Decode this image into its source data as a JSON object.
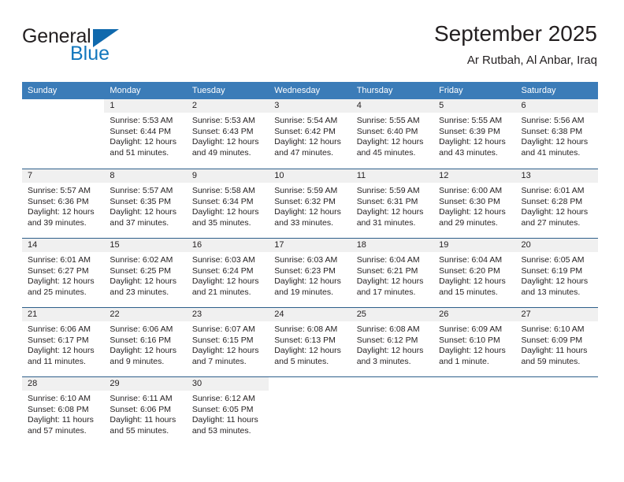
{
  "brand": {
    "name_part1": "General",
    "name_part2": "Blue",
    "triangle_color": "#1069ad",
    "blue_color": "#1277bd"
  },
  "header": {
    "title": "September 2025",
    "subtitle": "Ar Rutbah, Al Anbar, Iraq"
  },
  "calendar": {
    "header_bg": "#3b7cb8",
    "day_band_bg": "#f0f0f0",
    "row_divider": "#2e5f8a",
    "weekdays": [
      "Sunday",
      "Monday",
      "Tuesday",
      "Wednesday",
      "Thursday",
      "Friday",
      "Saturday"
    ],
    "weeks": [
      [
        {
          "day": "",
          "empty": true,
          "sunrise": "",
          "sunset": "",
          "daylight1": "",
          "daylight2": ""
        },
        {
          "day": "1",
          "sunrise": "Sunrise: 5:53 AM",
          "sunset": "Sunset: 6:44 PM",
          "daylight1": "Daylight: 12 hours",
          "daylight2": "and 51 minutes."
        },
        {
          "day": "2",
          "sunrise": "Sunrise: 5:53 AM",
          "sunset": "Sunset: 6:43 PM",
          "daylight1": "Daylight: 12 hours",
          "daylight2": "and 49 minutes."
        },
        {
          "day": "3",
          "sunrise": "Sunrise: 5:54 AM",
          "sunset": "Sunset: 6:42 PM",
          "daylight1": "Daylight: 12 hours",
          "daylight2": "and 47 minutes."
        },
        {
          "day": "4",
          "sunrise": "Sunrise: 5:55 AM",
          "sunset": "Sunset: 6:40 PM",
          "daylight1": "Daylight: 12 hours",
          "daylight2": "and 45 minutes."
        },
        {
          "day": "5",
          "sunrise": "Sunrise: 5:55 AM",
          "sunset": "Sunset: 6:39 PM",
          "daylight1": "Daylight: 12 hours",
          "daylight2": "and 43 minutes."
        },
        {
          "day": "6",
          "sunrise": "Sunrise: 5:56 AM",
          "sunset": "Sunset: 6:38 PM",
          "daylight1": "Daylight: 12 hours",
          "daylight2": "and 41 minutes."
        }
      ],
      [
        {
          "day": "7",
          "sunrise": "Sunrise: 5:57 AM",
          "sunset": "Sunset: 6:36 PM",
          "daylight1": "Daylight: 12 hours",
          "daylight2": "and 39 minutes."
        },
        {
          "day": "8",
          "sunrise": "Sunrise: 5:57 AM",
          "sunset": "Sunset: 6:35 PM",
          "daylight1": "Daylight: 12 hours",
          "daylight2": "and 37 minutes."
        },
        {
          "day": "9",
          "sunrise": "Sunrise: 5:58 AM",
          "sunset": "Sunset: 6:34 PM",
          "daylight1": "Daylight: 12 hours",
          "daylight2": "and 35 minutes."
        },
        {
          "day": "10",
          "sunrise": "Sunrise: 5:59 AM",
          "sunset": "Sunset: 6:32 PM",
          "daylight1": "Daylight: 12 hours",
          "daylight2": "and 33 minutes."
        },
        {
          "day": "11",
          "sunrise": "Sunrise: 5:59 AM",
          "sunset": "Sunset: 6:31 PM",
          "daylight1": "Daylight: 12 hours",
          "daylight2": "and 31 minutes."
        },
        {
          "day": "12",
          "sunrise": "Sunrise: 6:00 AM",
          "sunset": "Sunset: 6:30 PM",
          "daylight1": "Daylight: 12 hours",
          "daylight2": "and 29 minutes."
        },
        {
          "day": "13",
          "sunrise": "Sunrise: 6:01 AM",
          "sunset": "Sunset: 6:28 PM",
          "daylight1": "Daylight: 12 hours",
          "daylight2": "and 27 minutes."
        }
      ],
      [
        {
          "day": "14",
          "sunrise": "Sunrise: 6:01 AM",
          "sunset": "Sunset: 6:27 PM",
          "daylight1": "Daylight: 12 hours",
          "daylight2": "and 25 minutes."
        },
        {
          "day": "15",
          "sunrise": "Sunrise: 6:02 AM",
          "sunset": "Sunset: 6:25 PM",
          "daylight1": "Daylight: 12 hours",
          "daylight2": "and 23 minutes."
        },
        {
          "day": "16",
          "sunrise": "Sunrise: 6:03 AM",
          "sunset": "Sunset: 6:24 PM",
          "daylight1": "Daylight: 12 hours",
          "daylight2": "and 21 minutes."
        },
        {
          "day": "17",
          "sunrise": "Sunrise: 6:03 AM",
          "sunset": "Sunset: 6:23 PM",
          "daylight1": "Daylight: 12 hours",
          "daylight2": "and 19 minutes."
        },
        {
          "day": "18",
          "sunrise": "Sunrise: 6:04 AM",
          "sunset": "Sunset: 6:21 PM",
          "daylight1": "Daylight: 12 hours",
          "daylight2": "and 17 minutes."
        },
        {
          "day": "19",
          "sunrise": "Sunrise: 6:04 AM",
          "sunset": "Sunset: 6:20 PM",
          "daylight1": "Daylight: 12 hours",
          "daylight2": "and 15 minutes."
        },
        {
          "day": "20",
          "sunrise": "Sunrise: 6:05 AM",
          "sunset": "Sunset: 6:19 PM",
          "daylight1": "Daylight: 12 hours",
          "daylight2": "and 13 minutes."
        }
      ],
      [
        {
          "day": "21",
          "sunrise": "Sunrise: 6:06 AM",
          "sunset": "Sunset: 6:17 PM",
          "daylight1": "Daylight: 12 hours",
          "daylight2": "and 11 minutes."
        },
        {
          "day": "22",
          "sunrise": "Sunrise: 6:06 AM",
          "sunset": "Sunset: 6:16 PM",
          "daylight1": "Daylight: 12 hours",
          "daylight2": "and 9 minutes."
        },
        {
          "day": "23",
          "sunrise": "Sunrise: 6:07 AM",
          "sunset": "Sunset: 6:15 PM",
          "daylight1": "Daylight: 12 hours",
          "daylight2": "and 7 minutes."
        },
        {
          "day": "24",
          "sunrise": "Sunrise: 6:08 AM",
          "sunset": "Sunset: 6:13 PM",
          "daylight1": "Daylight: 12 hours",
          "daylight2": "and 5 minutes."
        },
        {
          "day": "25",
          "sunrise": "Sunrise: 6:08 AM",
          "sunset": "Sunset: 6:12 PM",
          "daylight1": "Daylight: 12 hours",
          "daylight2": "and 3 minutes."
        },
        {
          "day": "26",
          "sunrise": "Sunrise: 6:09 AM",
          "sunset": "Sunset: 6:10 PM",
          "daylight1": "Daylight: 12 hours",
          "daylight2": "and 1 minute."
        },
        {
          "day": "27",
          "sunrise": "Sunrise: 6:10 AM",
          "sunset": "Sunset: 6:09 PM",
          "daylight1": "Daylight: 11 hours",
          "daylight2": "and 59 minutes."
        }
      ],
      [
        {
          "day": "28",
          "sunrise": "Sunrise: 6:10 AM",
          "sunset": "Sunset: 6:08 PM",
          "daylight1": "Daylight: 11 hours",
          "daylight2": "and 57 minutes."
        },
        {
          "day": "29",
          "sunrise": "Sunrise: 6:11 AM",
          "sunset": "Sunset: 6:06 PM",
          "daylight1": "Daylight: 11 hours",
          "daylight2": "and 55 minutes."
        },
        {
          "day": "30",
          "sunrise": "Sunrise: 6:12 AM",
          "sunset": "Sunset: 6:05 PM",
          "daylight1": "Daylight: 11 hours",
          "daylight2": "and 53 minutes."
        },
        {
          "day": "",
          "empty": true,
          "sunrise": "",
          "sunset": "",
          "daylight1": "",
          "daylight2": ""
        },
        {
          "day": "",
          "empty": true,
          "sunrise": "",
          "sunset": "",
          "daylight1": "",
          "daylight2": ""
        },
        {
          "day": "",
          "empty": true,
          "sunrise": "",
          "sunset": "",
          "daylight1": "",
          "daylight2": ""
        },
        {
          "day": "",
          "empty": true,
          "sunrise": "",
          "sunset": "",
          "daylight1": "",
          "daylight2": ""
        }
      ]
    ]
  }
}
